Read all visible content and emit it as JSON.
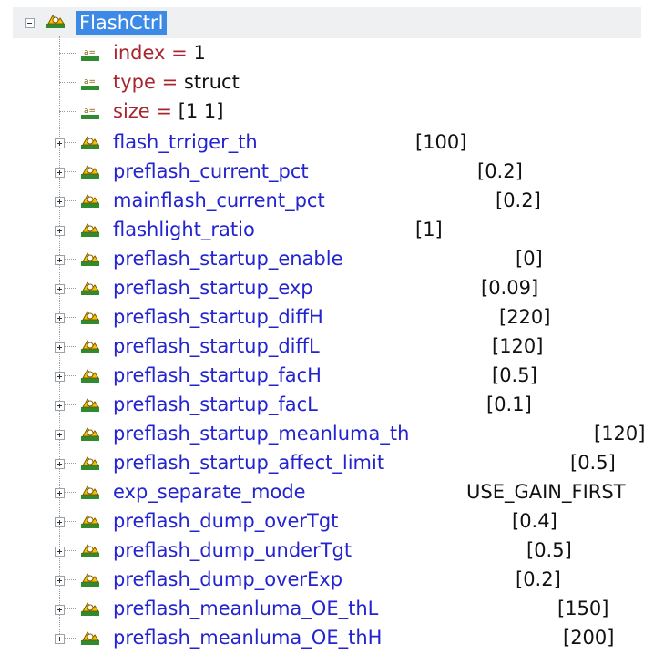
{
  "root": {
    "label": "FlashCtrl"
  },
  "params": [
    {
      "name": "index",
      "op": "=",
      "value": "1"
    },
    {
      "name": "type",
      "op": "=",
      "value": "struct"
    },
    {
      "name": "size",
      "op": "=",
      "value": "[1 1]"
    }
  ],
  "nodes": [
    {
      "name": "flash_trriger_th",
      "value": "[100]"
    },
    {
      "name": "preflash_current_pct",
      "value": "[0.2]"
    },
    {
      "name": "mainflash_current_pct",
      "value": "[0.2]"
    },
    {
      "name": "flashlight_ratio",
      "value": "[1]"
    },
    {
      "name": "preflash_startup_enable",
      "value": "[0]"
    },
    {
      "name": "preflash_startup_exp",
      "value": "[0.09]"
    },
    {
      "name": "preflash_startup_diffH",
      "value": "[220]"
    },
    {
      "name": "preflash_startup_diffL",
      "value": "[120]"
    },
    {
      "name": "preflash_startup_facH",
      "value": "[0.5]"
    },
    {
      "name": "preflash_startup_facL",
      "value": "[0.1]"
    },
    {
      "name": "preflash_startup_meanluma_th",
      "value": "[120]"
    },
    {
      "name": "preflash_startup_affect_limit",
      "value": "[0.5]"
    },
    {
      "name": "exp_separate_mode",
      "value": "USE_GAIN_FIRST"
    },
    {
      "name": "preflash_dump_overTgt",
      "value": "[0.4]"
    },
    {
      "name": "preflash_dump_underTgt",
      "value": "[0.5]"
    },
    {
      "name": "preflash_dump_overExp",
      "value": "[0.2]"
    },
    {
      "name": "preflash_meanluma_OE_thL",
      "value": "[150]"
    },
    {
      "name": "preflash_meanluma_OE_thH",
      "value": "[200]"
    }
  ],
  "icons": {
    "struct": "struct-node-icon",
    "param": "parameter-icon"
  },
  "colors": {
    "selection": "#3c8ae6",
    "node_text": "#2323d0",
    "param_text": "#a8262f"
  }
}
